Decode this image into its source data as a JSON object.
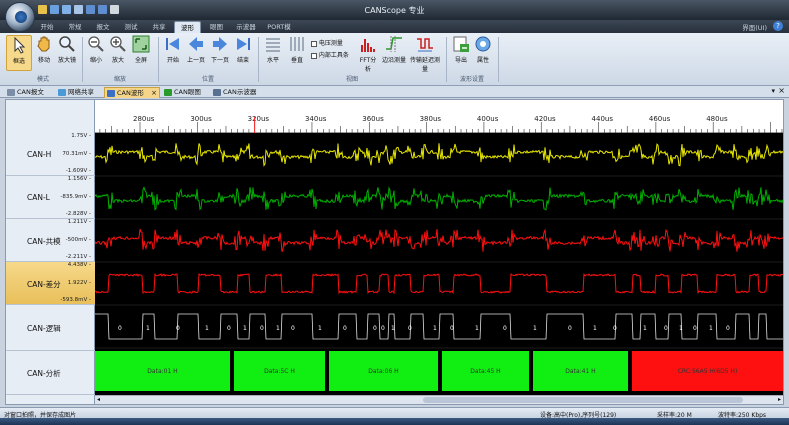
{
  "window": {
    "title": "CANScope 专业",
    "skin": "界面(UI)"
  },
  "ribbon_tabs": [
    "开始",
    "常规",
    "报文",
    "测试",
    "共享",
    "波形",
    "眼图",
    "示波器",
    "PORT模"
  ],
  "ribbon_active": 5,
  "ribbon_groups": {
    "mode": "模式",
    "zoom": "缩放",
    "position": "位置",
    "view": "视图",
    "settings": "波形设置"
  },
  "buttons": {
    "select": "框选",
    "move": "移动",
    "magnify": "放大镜",
    "zoom_out": "缩小",
    "zoom_in": "放大",
    "fullscreen": "全屏",
    "start": "开始",
    "prev_page": "上一页",
    "next_page": "下一页",
    "end": "结束",
    "horizontal": "水平",
    "vertical": "垂直",
    "volt_measure": "电压测量",
    "internal_tools": "内部工具条",
    "fft": "FFT分析",
    "edge_measure": "边沿测量",
    "delay_measure": "传输延迟测量",
    "export": "导出",
    "properties": "属性"
  },
  "doc_tabs": [
    "CAN报文",
    "网络共享",
    "CAN波形",
    "CAN眼图",
    "CAN示波器"
  ],
  "doc_tab_active": 2,
  "ruler_ticks": [
    "280us",
    "300us",
    "320us",
    "340us",
    "360us",
    "380us",
    "400us",
    "420us",
    "440us",
    "460us",
    "480us"
  ],
  "lanes": [
    {
      "name": "CAN-H",
      "top": "1.75V",
      "mid": "70.31mV",
      "bottom": "-1.609V",
      "color": "#e8e800"
    },
    {
      "name": "CAN-L",
      "top": "1.156V",
      "mid": "-835.9mV",
      "bottom": "-2.828V",
      "color": "#00b000"
    },
    {
      "name": "CAN-共模",
      "top": "1.211V",
      "mid": "-500mV",
      "bottom": "-2.211V",
      "color": "#ff1010"
    },
    {
      "name": "CAN-差分",
      "top": "4.438V",
      "mid": "1.922V",
      "bottom": "-593.8mV",
      "color": "#ff1010"
    },
    {
      "name": "CAN-逻辑"
    },
    {
      "name": "CAN-分析"
    }
  ],
  "logic_labels": [
    "0",
    "1",
    "0",
    "1",
    "0",
    "1",
    "0",
    "1",
    "0",
    "1",
    "0",
    "0",
    "0",
    "1",
    "0",
    "1",
    "0",
    "1",
    "0",
    "1",
    "0",
    "1",
    "0",
    "1",
    "0",
    "1",
    "0",
    "1",
    "0"
  ],
  "analysis": [
    {
      "label": "Data:01 H",
      "color": "#11ee11"
    },
    {
      "label": "Data:5C H",
      "color": "#11ee11"
    },
    {
      "label": "Data:06 H",
      "color": "#11ee11"
    },
    {
      "label": "Data:45 H",
      "color": "#11ee11"
    },
    {
      "label": "Data:41 H",
      "color": "#11ee11"
    },
    {
      "label": "CRC:56A5 H(6D5 H)",
      "color": "#ff1010"
    }
  ],
  "status": {
    "left": "对窗口拍照，并保存成图片",
    "device": "设备:高中(Pro),序列号(129)",
    "sample_rate": "采样率:20 M",
    "baud": "波特率:250 Kbps"
  }
}
